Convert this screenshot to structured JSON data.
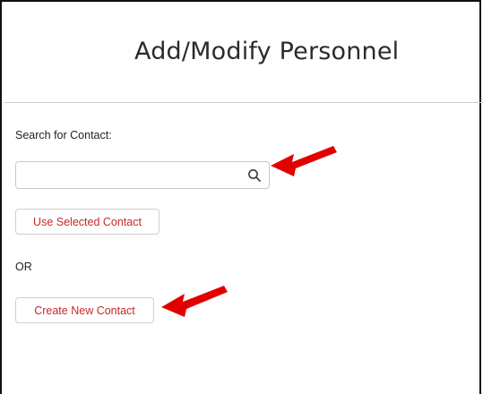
{
  "header": {
    "title": "Add/Modify Personnel"
  },
  "search": {
    "label": "Search for Contact:",
    "value": "",
    "placeholder": "",
    "icon": "search-icon"
  },
  "buttons": {
    "use_selected": "Use Selected Contact",
    "or_label": "OR",
    "create_new": "Create New Contact"
  },
  "annotations": {
    "arrow_color": "#e10000",
    "button_text_color": "#c62828"
  }
}
